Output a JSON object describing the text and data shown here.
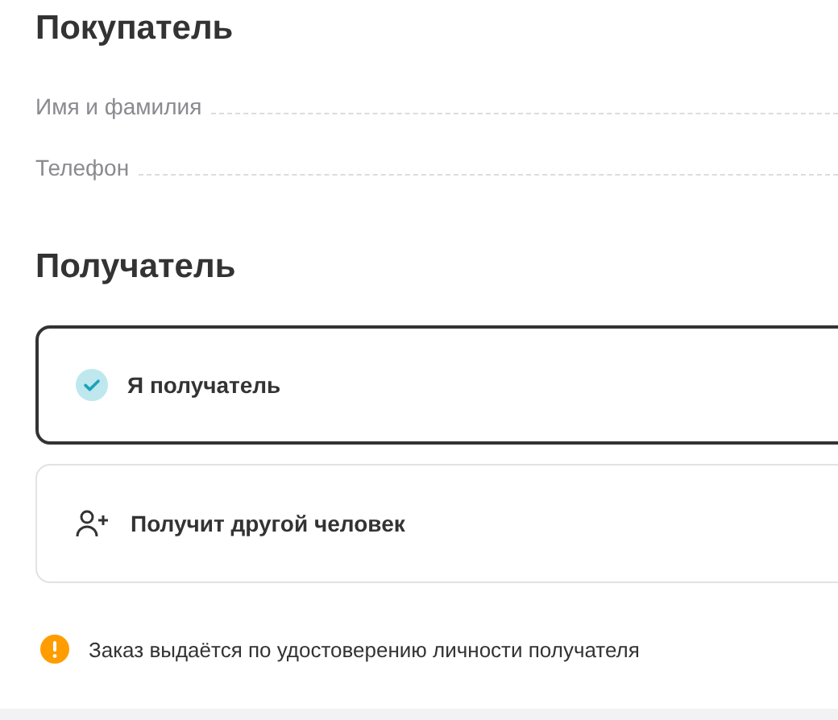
{
  "buyer": {
    "title": "Покупатель",
    "fields": [
      {
        "label": "Имя и фамилия"
      },
      {
        "label": "Телефон"
      }
    ]
  },
  "recipient": {
    "title": "Получатель",
    "options": [
      {
        "kind": "self",
        "label": "Я получатель",
        "selected": true
      },
      {
        "kind": "other",
        "label": "Получит другой человек",
        "selected": false
      }
    ]
  },
  "note": {
    "text": "Заказ выдаётся по удостоверению личности получателя"
  }
}
